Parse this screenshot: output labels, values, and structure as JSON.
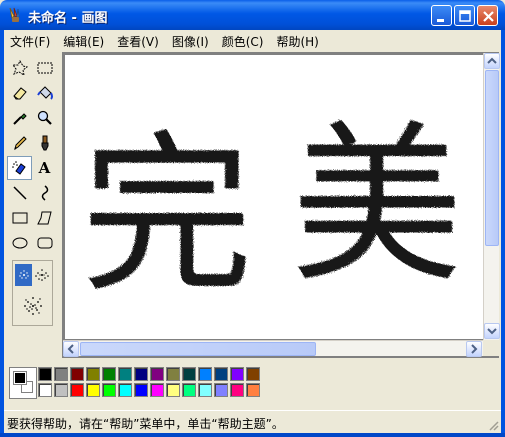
{
  "window": {
    "title": "未命名 - 画图",
    "icon": "paint-brush-icon"
  },
  "menu": [
    "文件(F)",
    "编辑(E)",
    "查看(V)",
    "图像(I)",
    "颜色(C)",
    "帮助(H)"
  ],
  "tools": [
    "free-select-icon",
    "rect-select-icon",
    "eraser-icon",
    "fill-icon",
    "color-picker-icon",
    "magnifier-icon",
    "pencil-icon",
    "brush-icon",
    "airbrush-icon",
    "text-icon",
    "line-icon",
    "curve-icon",
    "rectangle-icon",
    "polygon-icon",
    "ellipse-icon",
    "rounded-rect-icon"
  ],
  "tool_text": {
    "text_tool_glyph": "A"
  },
  "canvas_text": [
    "完",
    "美"
  ],
  "palette": {
    "foreground": "#000000",
    "background": "#ffffff",
    "row1": [
      "#000000",
      "#808080",
      "#800000",
      "#808000",
      "#008000",
      "#008080",
      "#000080",
      "#800080",
      "#808040",
      "#004040",
      "#0080ff",
      "#004080",
      "#8000ff",
      "#804000"
    ],
    "row2": [
      "#ffffff",
      "#c0c0c0",
      "#ff0000",
      "#ffff00",
      "#00ff00",
      "#00ffff",
      "#0000ff",
      "#ff00ff",
      "#ffff80",
      "#00ff80",
      "#80ffff",
      "#8080ff",
      "#ff0080",
      "#ff8040"
    ]
  },
  "status": "要获得帮助，请在“帮助”菜单中，单击“帮助主题”。"
}
